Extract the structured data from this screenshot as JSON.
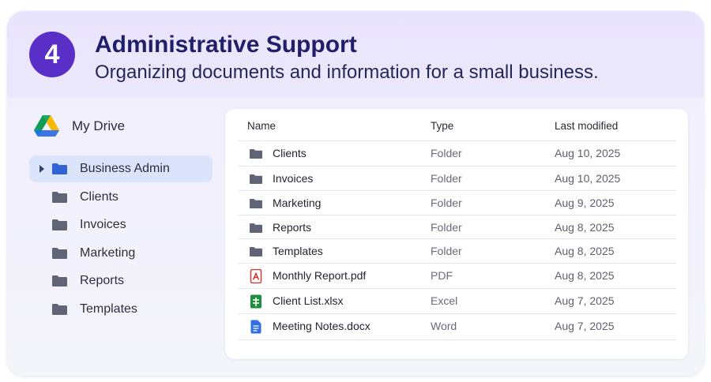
{
  "header": {
    "step_number": "4",
    "title": "Administrative Support",
    "subtitle": "Organizing documents and information for a small business."
  },
  "sidebar": {
    "root_label": "My Drive",
    "items": [
      {
        "label": "Business Admin",
        "selected": true,
        "icon": "folder-icon"
      },
      {
        "label": "Clients",
        "selected": false,
        "icon": "folder-icon"
      },
      {
        "label": "Invoices",
        "selected": false,
        "icon": "folder-icon"
      },
      {
        "label": "Marketing",
        "selected": false,
        "icon": "folder-icon"
      },
      {
        "label": "Reports",
        "selected": false,
        "icon": "folder-icon"
      },
      {
        "label": "Templates",
        "selected": false,
        "icon": "folder-icon"
      }
    ]
  },
  "table": {
    "columns": [
      "Name",
      "Type",
      "Last modified"
    ],
    "rows": [
      {
        "name": "Clients",
        "type": "Folder",
        "modified": "Aug 10, 2025",
        "icon": "folder-icon"
      },
      {
        "name": "Invoices",
        "type": "Folder",
        "modified": "Aug 10, 2025",
        "icon": "folder-icon"
      },
      {
        "name": "Marketing",
        "type": "Folder",
        "modified": "Aug 9, 2025",
        "icon": "folder-icon"
      },
      {
        "name": "Reports",
        "type": "Folder",
        "modified": "Aug 8, 2025",
        "icon": "folder-icon"
      },
      {
        "name": "Templates",
        "type": "Folder",
        "modified": "Aug 8, 2025",
        "icon": "folder-icon"
      },
      {
        "name": "Monthly Report.pdf",
        "type": "PDF",
        "modified": "Aug 8, 2025",
        "icon": "pdf-icon"
      },
      {
        "name": "Client List.xlsx",
        "type": "Excel",
        "modified": "Aug 7, 2025",
        "icon": "spreadsheet-icon"
      },
      {
        "name": "Meeting Notes.docx",
        "type": "Word",
        "modified": "Aug 7, 2025",
        "icon": "document-icon"
      }
    ]
  },
  "colors": {
    "badge": "#5a2fc7",
    "title": "#221f6a",
    "selected_bg": "#dbe4fb",
    "folder_selected": "#2f63d6",
    "folder": "#5f6577",
    "pdf": "#d93025",
    "spreadsheet": "#1e8e3e",
    "document": "#2f6fe0"
  }
}
